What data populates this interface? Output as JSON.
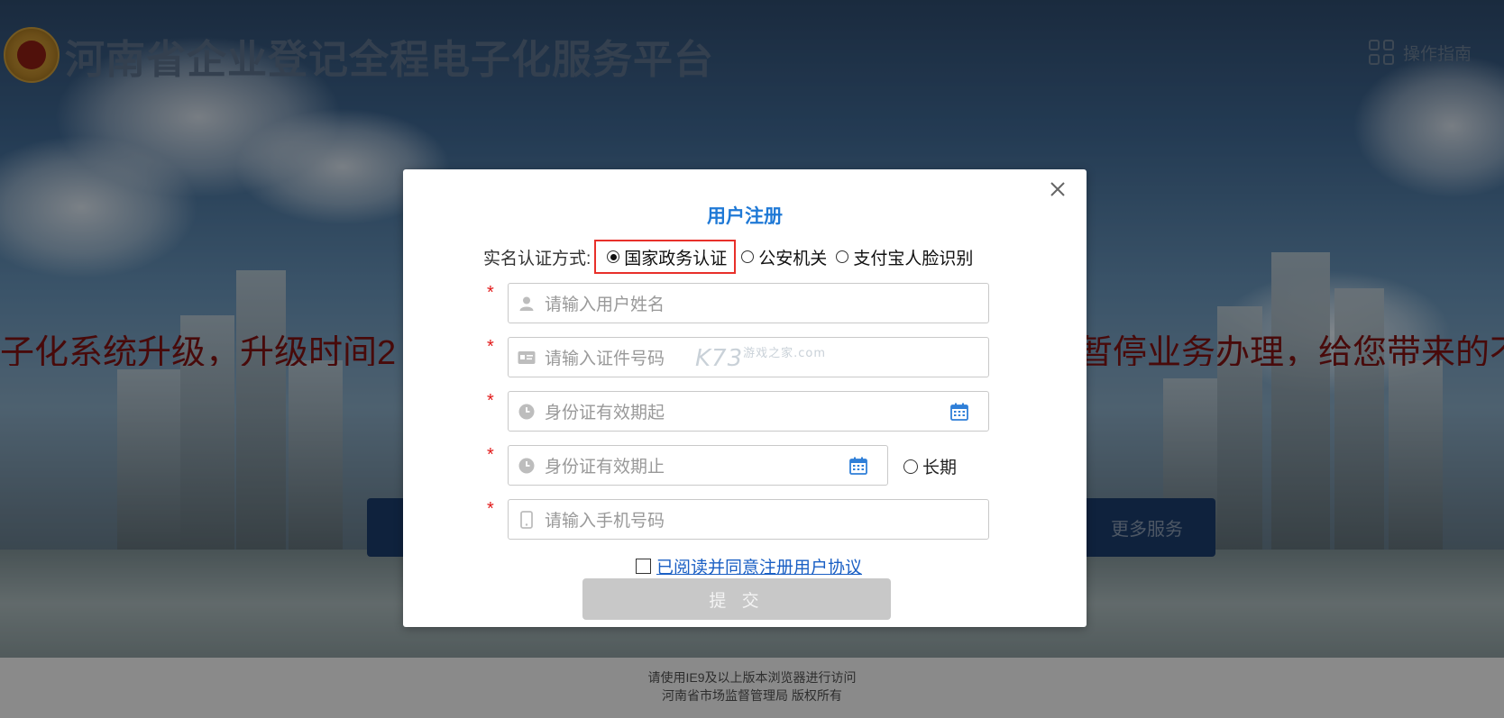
{
  "header": {
    "site_title": "河南省企业登记全程电子化服务平台",
    "guide_label": "操作指南"
  },
  "notice": {
    "left_text": "子化系统升级，升级时间2",
    "right_text": "暂停业务办理，给您带来的不"
  },
  "background_buttons": {
    "more_services": "更多服务"
  },
  "footer": {
    "line1": "请使用IE9及以上版本浏览器进行访问",
    "line2": "河南省市场监督管理局 版权所有"
  },
  "modal": {
    "title": "用户注册",
    "auth_label": "实名认证方式:",
    "auth_options": [
      {
        "label": "国家政务认证",
        "selected": true
      },
      {
        "label": "公安机关",
        "selected": false
      },
      {
        "label": "支付宝人脸识别",
        "selected": false
      }
    ],
    "required_mark": "*",
    "fields": {
      "name_placeholder": "请输入用户姓名",
      "id_placeholder": "请输入证件号码",
      "valid_from_placeholder": "身份证有效期起",
      "valid_to_placeholder": "身份证有效期止",
      "phone_placeholder": "请输入手机号码"
    },
    "long_term_label": "长期",
    "agree_label": "已阅读并同意注册用户协议",
    "submit_label": "提 交"
  },
  "watermark": {
    "main": "K73",
    "sub": "游戏之家",
    "domain": ".com"
  },
  "colors": {
    "title_blue": "#1f79d6",
    "required_red": "#e21a1a",
    "highlight_red": "#e8302a",
    "link_blue": "#1a5fc4",
    "notice_red": "#7c1212"
  }
}
